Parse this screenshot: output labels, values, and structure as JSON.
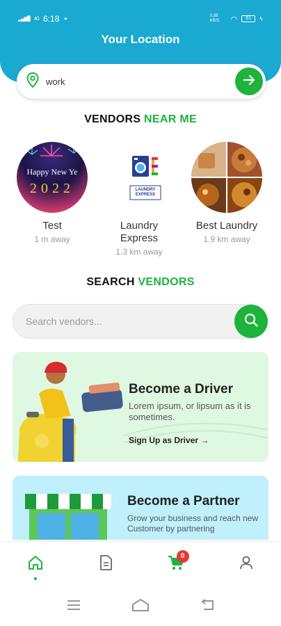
{
  "status": {
    "carrier": "4G",
    "time": "6:18",
    "speed": "0.38 KB/S",
    "battery": "61"
  },
  "header": {
    "title": "Your Location"
  },
  "location": {
    "value": "work"
  },
  "vendors_near": {
    "title_a": "VENDORS",
    "title_b": "NEAR ME"
  },
  "vendors": [
    {
      "name": "Test",
      "distance": "1 m away",
      "image_text_a": "Happy New Ye",
      "image_text_b": "2022"
    },
    {
      "name": "Laundry Express",
      "distance": "1.3 km away",
      "logo_text": "LAUNDRY EXPRESS"
    },
    {
      "name": "Best Laundry",
      "distance": "1.9 km away"
    }
  ],
  "search_vendors": {
    "title_a": "SEARCH",
    "title_b": "VENDORS",
    "placeholder": "Search vendors..."
  },
  "driver_card": {
    "title": "Become a Driver",
    "desc": "Lorem ipsum, or lipsum as it is sometimes.",
    "link": "Sign Up as Driver →"
  },
  "partner_card": {
    "title": "Become a Partner",
    "desc": "Grow your business and reach new Customer by partnering"
  },
  "cart": {
    "count": "0"
  },
  "colors": {
    "header": "#1aa9d1",
    "accent": "#1db33c",
    "badge": "#e53935"
  }
}
